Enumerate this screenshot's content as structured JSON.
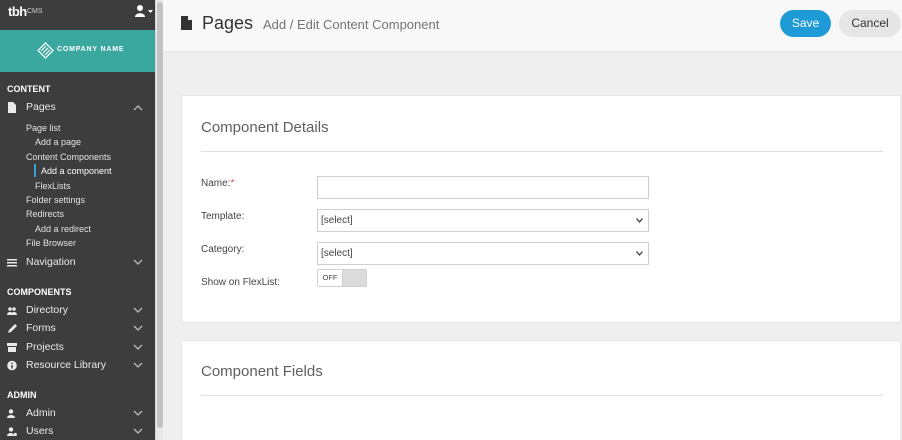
{
  "brand": {
    "logo": "tbh",
    "product": "CMS",
    "company": "COMPANY NAME"
  },
  "sidebar": {
    "sections": {
      "content": "CONTENT",
      "components": "COMPONENTS",
      "admin": "ADMIN"
    },
    "pages": "Pages",
    "sub_items": [
      "Page list",
      "Add a page",
      "Content Components",
      "Add a component",
      "FlexLists",
      "Folder settings",
      "Redirects",
      "Add a redirect",
      "File Browser"
    ],
    "navigation": "Navigation",
    "directory": "Directory",
    "forms": "Forms",
    "projects": "Projects",
    "resource_library": "Resource Library",
    "admin": "Admin",
    "users": "Users"
  },
  "header": {
    "title": "Pages",
    "subtitle": "Add / Edit Content Component",
    "save_label": "Save",
    "cancel_label": "Cancel"
  },
  "details": {
    "title": "Component Details",
    "name_label": "Name:",
    "name_required": "*",
    "name_value": "",
    "template_label": "Template:",
    "template_value": "[select]",
    "category_label": "Category:",
    "category_value": "[select]",
    "flexlist_label": "Show on FlexList:",
    "flexlist_state": "OFF"
  },
  "fields": {
    "title": "Component Fields"
  },
  "colors": {
    "accent": "#1e9bd7",
    "brand_teal": "#3aa89f",
    "sidebar_bg": "#3d3d3d",
    "required": "#d9534f"
  }
}
